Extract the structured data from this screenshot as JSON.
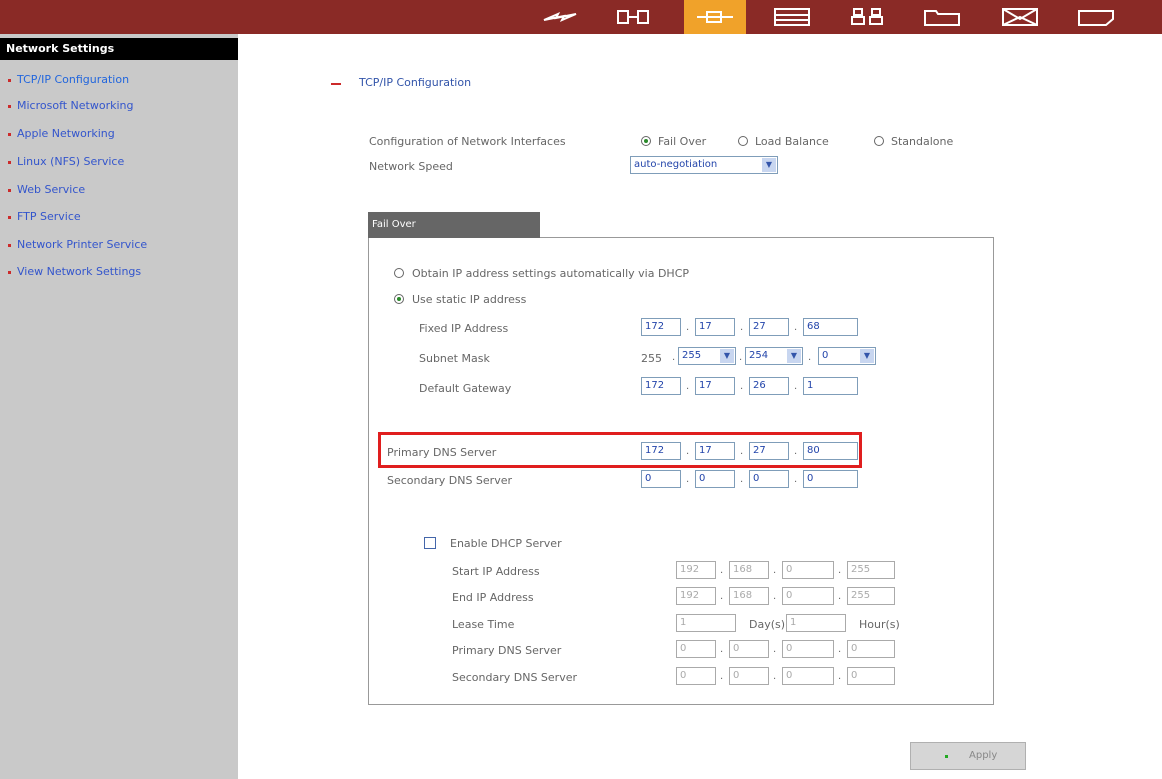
{
  "topbar": {
    "icons": [
      "network-wizard-icon",
      "disk-icon",
      "network-icon",
      "storage-icon",
      "users-icon",
      "folder-icon",
      "mail-icon",
      "backup-icon"
    ],
    "active_icon": "network-icon",
    "accent": "#f0a22a",
    "bg": "#8a2a26"
  },
  "sidebar": {
    "title": "Network Settings",
    "items": [
      {
        "label": "TCP/IP Configuration"
      },
      {
        "label": "Microsoft Networking"
      },
      {
        "label": "Apple Networking"
      },
      {
        "label": "Linux (NFS) Service"
      },
      {
        "label": "Web Service"
      },
      {
        "label": "FTP Service"
      },
      {
        "label": "Network Printer Service"
      },
      {
        "label": "View Network Settings"
      }
    ]
  },
  "main": {
    "section_title": "TCP/IP Configuration",
    "config_label": "Configuration of Network Interfaces",
    "config_options": [
      "Fail Over",
      "Load Balance",
      "Standalone"
    ],
    "config_selected": "Fail Over",
    "speed_label": "Network Speed",
    "speed_value": "auto-negotiation",
    "tab_label": "Fail Over",
    "dhcp_option": "Obtain IP address settings automatically via DHCP",
    "static_option": "Use static IP address",
    "fixed_ip_label": "Fixed IP Address",
    "fixed_ip": [
      "172",
      "17",
      "27",
      "68"
    ],
    "subnet_label": "Subnet Mask",
    "subnet_prefix": "255",
    "subnet": [
      "255",
      "254",
      "0"
    ],
    "gateway_label": "Default Gateway",
    "gateway": [
      "172",
      "17",
      "26",
      "1"
    ],
    "primary_dns_label": "Primary DNS Server",
    "primary_dns": [
      "172",
      "17",
      "27",
      "80"
    ],
    "secondary_dns_label": "Secondary DNS Server",
    "secondary_dns": [
      "0",
      "0",
      "0",
      "0"
    ],
    "dhcp_server": {
      "enable_label": "Enable DHCP Server",
      "start_label": "Start IP Address",
      "start": [
        "192",
        "168",
        "0",
        "255"
      ],
      "end_label": "End IP Address",
      "end": [
        "192",
        "168",
        "0",
        "255"
      ],
      "lease_label": "Lease Time",
      "lease_days": "1",
      "days_unit": "Day(s)",
      "lease_hours": "1",
      "hours_unit": "Hour(s)",
      "primary_dns_label": "Primary DNS Server",
      "primary_dns": [
        "0",
        "0",
        "0",
        "0"
      ],
      "secondary_dns_label": "Secondary DNS Server",
      "secondary_dns": [
        "0",
        "0",
        "0",
        "0"
      ]
    },
    "apply_label": "Apply"
  }
}
